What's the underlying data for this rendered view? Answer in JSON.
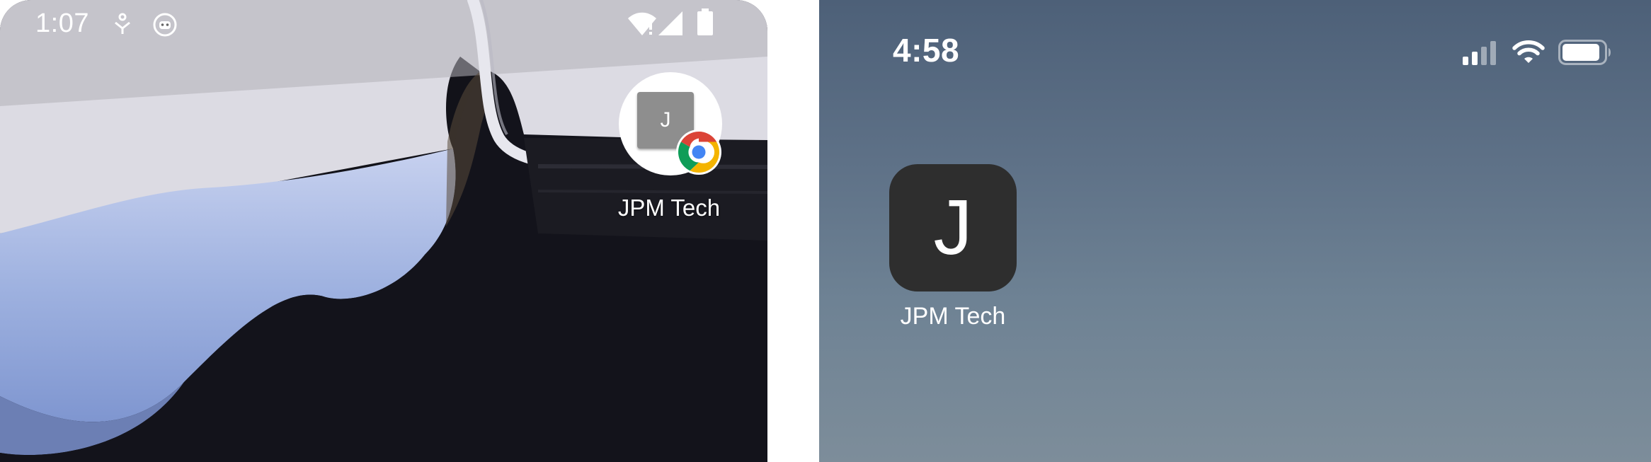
{
  "android": {
    "status_bar": {
      "time": "1:07",
      "icons": [
        "accessibility-icon",
        "android-robot-icon",
        "wifi-alert-icon",
        "cell-signal-icon",
        "battery-icon"
      ]
    },
    "shortcut": {
      "badge_letter": "J",
      "badge_icon": "chrome-icon",
      "label": "JPM Tech"
    }
  },
  "ios": {
    "status_bar": {
      "time": "4:58",
      "icons": [
        "cell-signal-icon",
        "wifi-icon",
        "battery-icon"
      ]
    },
    "app": {
      "letter": "J",
      "label": "JPM Tech"
    }
  }
}
